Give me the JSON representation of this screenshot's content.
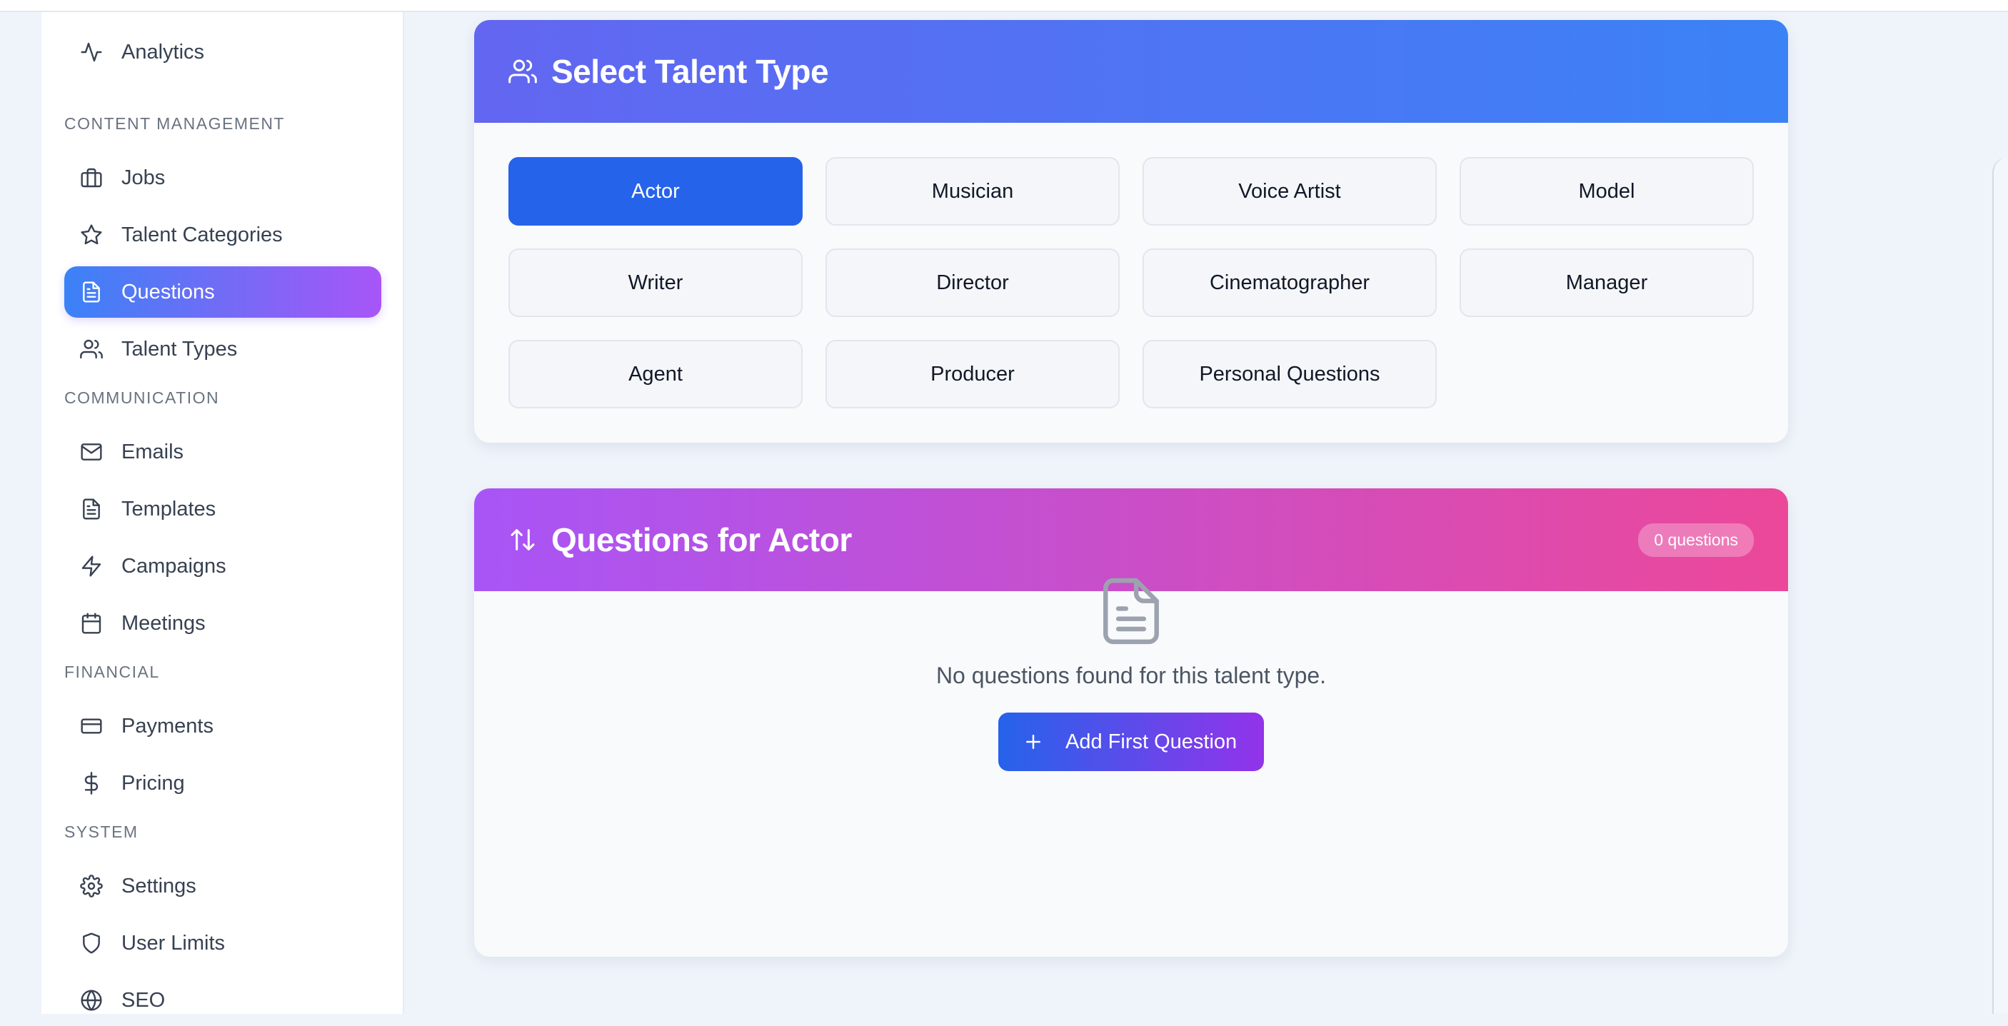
{
  "sidebar": {
    "items": {
      "analytics": "Analytics",
      "jobs": "Jobs",
      "talent_categories": "Talent Categories",
      "questions": "Questions",
      "talent_types": "Talent Types",
      "emails": "Emails",
      "templates": "Templates",
      "campaigns": "Campaigns",
      "meetings": "Meetings",
      "payments": "Payments",
      "pricing": "Pricing",
      "settings": "Settings",
      "user_limits": "User Limits",
      "seo": "SEO"
    },
    "sections": {
      "content_management": "CONTENT MANAGEMENT",
      "communication": "COMMUNICATION",
      "financial": "FINANCIAL",
      "system": "SYSTEM"
    },
    "active_item": "Questions"
  },
  "talent_type_card": {
    "title": "Select Talent Type",
    "options": [
      "Actor",
      "Musician",
      "Voice Artist",
      "Model",
      "Writer",
      "Director",
      "Cinematographer",
      "Manager",
      "Agent",
      "Producer",
      "Personal Questions"
    ],
    "selected": "Actor"
  },
  "questions_card": {
    "title": "Questions for Actor",
    "count_badge": "0 questions",
    "empty_message": "No questions found for this talent type.",
    "add_button": "Add First Question"
  },
  "colors": {
    "accent_blue": "#2563eb",
    "header_gradient_blue": [
      "#6366f1",
      "#3b82f6"
    ],
    "header_gradient_pink": [
      "#a855f7",
      "#ec4899"
    ]
  },
  "icons": {
    "analytics": "activity-icon",
    "jobs": "briefcase-icon",
    "talent_categories": "star-icon",
    "questions": "document-icon",
    "talent_types": "users-icon",
    "emails": "mail-icon",
    "templates": "document-icon",
    "campaigns": "lightning-icon",
    "meetings": "calendar-icon",
    "payments": "credit-card-icon",
    "pricing": "dollar-icon",
    "settings": "gear-icon",
    "user_limits": "shield-icon",
    "seo": "globe-icon"
  }
}
